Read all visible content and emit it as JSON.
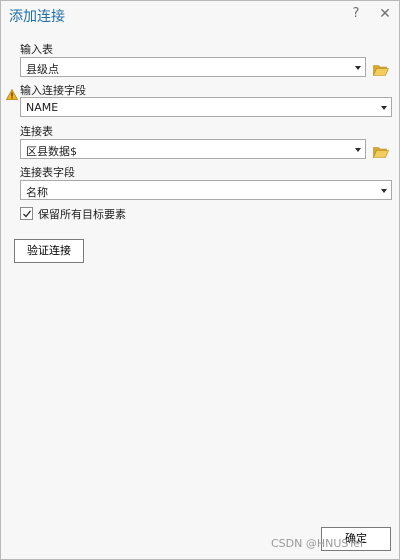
{
  "window": {
    "title": "添加连接",
    "help_glyph": "?",
    "close_glyph": "✕"
  },
  "form": {
    "input_table": {
      "label": "输入表",
      "value": "县级点"
    },
    "input_join_field": {
      "label": "输入连接字段",
      "value": "NAME",
      "warning_icon": "warning-icon"
    },
    "join_table": {
      "label": "连接表",
      "value": "区县数据$"
    },
    "join_table_field": {
      "label": "连接表字段",
      "value": "名称"
    },
    "keep_all": {
      "label": "保留所有目标要素",
      "checked": true
    }
  },
  "buttons": {
    "validate_label": "验证连接",
    "ok_label": "确定"
  },
  "watermark": "CSDN @HNUSTer",
  "colors": {
    "title": "#1f6fa8",
    "folder": "#e8c04a",
    "warning": "#f0b323"
  }
}
